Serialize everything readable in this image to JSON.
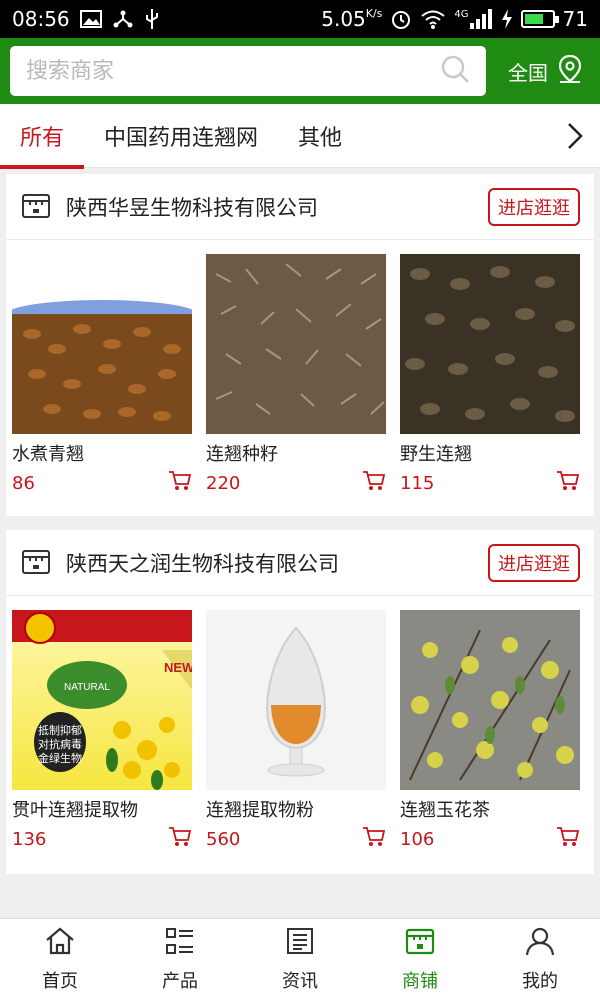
{
  "status_bar": {
    "time": "08:56",
    "speed": "5.05",
    "speed_unit": "K/s",
    "network": "4G",
    "battery": "71",
    "battery_fraction": 0.71
  },
  "search": {
    "placeholder": "搜索商家",
    "region": "全国"
  },
  "tabs": [
    {
      "label": "所有",
      "active": true
    },
    {
      "label": "中国药用连翘网",
      "active": false
    },
    {
      "label": "其他",
      "active": false
    }
  ],
  "stores": [
    {
      "name": "陕西华昱生物科技有限公司",
      "enter_label": "进店逛逛",
      "products": [
        {
          "name": "水煮青翘",
          "price": "86"
        },
        {
          "name": "连翘种籽",
          "price": "220"
        },
        {
          "name": "野生连翘",
          "price": "115"
        }
      ]
    },
    {
      "name": "陕西天之润生物科技有限公司",
      "enter_label": "进店逛逛",
      "products": [
        {
          "name": "贯叶连翘提取物",
          "price": "136",
          "badge": "抵制抑郁 对抗病毒 金绿生物",
          "seal": "NATURAL",
          "corner": "NEW"
        },
        {
          "name": "连翘提取物粉",
          "price": "560"
        },
        {
          "name": "连翘玉花茶",
          "price": "106"
        }
      ]
    }
  ],
  "bottom_nav": [
    {
      "label": "首页",
      "icon": "home-icon"
    },
    {
      "label": "产品",
      "icon": "grid-list-icon"
    },
    {
      "label": "资讯",
      "icon": "news-icon"
    },
    {
      "label": "商铺",
      "icon": "store-icon",
      "active": true
    },
    {
      "label": "我的",
      "icon": "user-icon"
    }
  ],
  "colors": {
    "brand_green": "#1f8b12",
    "accent_red": "#c8161d"
  }
}
